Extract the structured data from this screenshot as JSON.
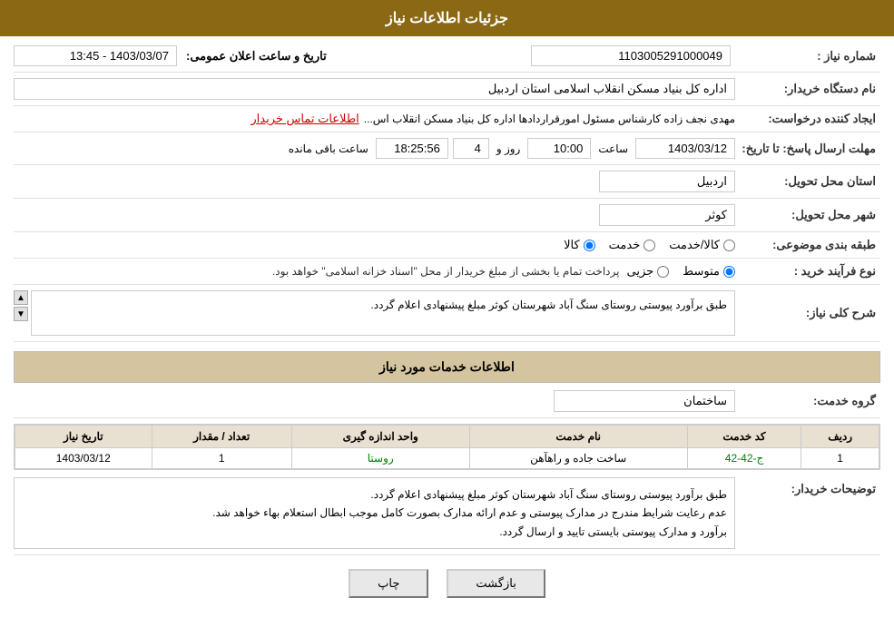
{
  "header": {
    "title": "جزئیات اطلاعات نیاز"
  },
  "fields": {
    "shomareNiaz_label": "شماره نیاز :",
    "shomareNiaz_value": "1103005291000049",
    "namDastgah_label": "نام دستگاه خریدار:",
    "namDastgah_value": "اداره کل بنیاد مسکن انقلاب اسلامی استان اردبیل",
    "ijadKonande_label": "ایجاد کننده درخواست:",
    "ijadKonande_value": "مهدی نجف زاده کارشناس مسئول امورقراردادها اداره کل بنیاد مسکن انقلاب اس...",
    "ijadKonande_link": "اطلاعات تماس خریدار",
    "mohlatErsal_label": "مهلت ارسال پاسخ: تا تاریخ:",
    "mohlatErsal_date": "1403/03/12",
    "mohlatErsal_saat_label": "ساعت",
    "mohlatErsal_saat": "10:00",
    "mohlatErsal_roz_label": "روز و",
    "mohlatErsal_roz": "4",
    "mohlatErsal_baqi": "18:25:56",
    "mohlatErsal_baqi_label": "ساعت باقی مانده",
    "tarikhAelanLabel": "تاریخ و ساعت اعلان عمومی:",
    "tarikhAelan": "1403/03/07 - 13:45",
    "ostan_label": "استان محل تحویل:",
    "ostan_value": "اردبیل",
    "shahr_label": "شهر محل تحویل:",
    "shahr_value": "کوثر",
    "tabaqebandiLabel": "طبقه بندی موضوعی:",
    "tabaqebandi_options": [
      "کالا",
      "خدمت",
      "کالا/خدمت"
    ],
    "tabaqebandi_selected": "کالا",
    "noeFarayandLabel": "نوع فرآیند خرید :",
    "noeFarayand_options": [
      "جزیی",
      "متوسط"
    ],
    "noeFarayand_selected": "متوسط",
    "noeFarayand_note": "پرداخت تمام یا بخشی از مبلغ خریدار از محل \"اسناد خزانه اسلامی\" خواهد بود.",
    "sharhKoliLabel": "شرح کلی نیاز:",
    "sharhKoli_value": "طبق برآورد پیوستی روستای سنگ آباد شهرستان کوثر مبلغ پیشنهادی اعلام گردد.",
    "khadamatSectionTitle": "اطلاعات خدمات مورد نیاز",
    "groupKhadamat_label": "گروه خدمت:",
    "groupKhadamat_value": "ساختمان",
    "tableHeaders": {
      "radif": "ردیف",
      "kod": "کد خدمت",
      "nam": "نام خدمت",
      "vahed": "واحد اندازه گیری",
      "tedad": "تعداد / مقدار",
      "tarikh": "تاریخ نیاز"
    },
    "tableRows": [
      {
        "radif": "1",
        "kod": "ج-42-42",
        "nam": "ساخت جاده و راهآهن",
        "vahed": "روستا",
        "tedad": "1",
        "tarikh": "1403/03/12"
      }
    ],
    "tosihKhridarLabel": "توضیحات خریدار:",
    "tosihKhridar_value": "طبق برآورد پیوستی روستای سنگ آباد شهرستان کوثر مبلغ پیشنهادی اعلام گردد.\nعدم رعایت شرایط مندرج در مدارک پیوستی و عدم ارائه مدارک بصورت کامل موجب ابطال استعلام بهاء خواهد شد.\nبرآورد و مدارک پیوستی بایستی تایید و ارسال گردد."
  },
  "buttons": {
    "bazgasht": "بازگشت",
    "chap": "چاپ"
  }
}
